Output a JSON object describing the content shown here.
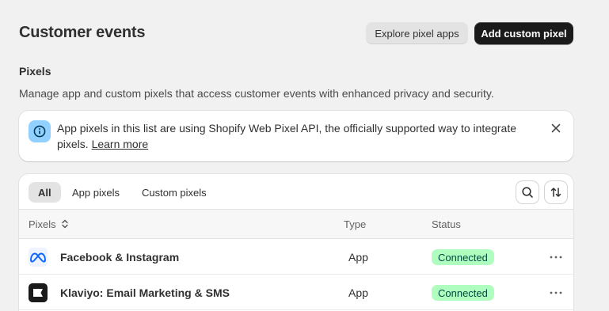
{
  "header": {
    "title": "Customer events",
    "explore_label": "Explore pixel apps",
    "add_label": "Add custom pixel"
  },
  "section": {
    "title": "Pixels",
    "description": "Manage app and custom pixels that access customer events with enhanced privacy and security."
  },
  "banner": {
    "text": "App pixels in this list are using Shopify Web Pixel API, the officially supported way to integrate pixels.",
    "link": "Learn more",
    "icon": "info-icon",
    "accent": "#91d0ff"
  },
  "tabs": [
    {
      "label": "All",
      "active": true
    },
    {
      "label": "App pixels",
      "active": false
    },
    {
      "label": "Custom pixels",
      "active": false
    }
  ],
  "table": {
    "columns": [
      "Pixels",
      "Type",
      "Status"
    ],
    "rows": [
      {
        "name": "Facebook & Instagram",
        "type": "App",
        "status": "Connected",
        "icon": "meta-logo-icon"
      },
      {
        "name": "Klaviyo: Email Marketing & SMS",
        "type": "App",
        "status": "Connected",
        "icon": "klaviyo-logo-icon"
      }
    ]
  },
  "colors": {
    "primary_button": "#1a1a1a",
    "status_badge_bg": "#affebf",
    "status_badge_text": "#014b40"
  }
}
